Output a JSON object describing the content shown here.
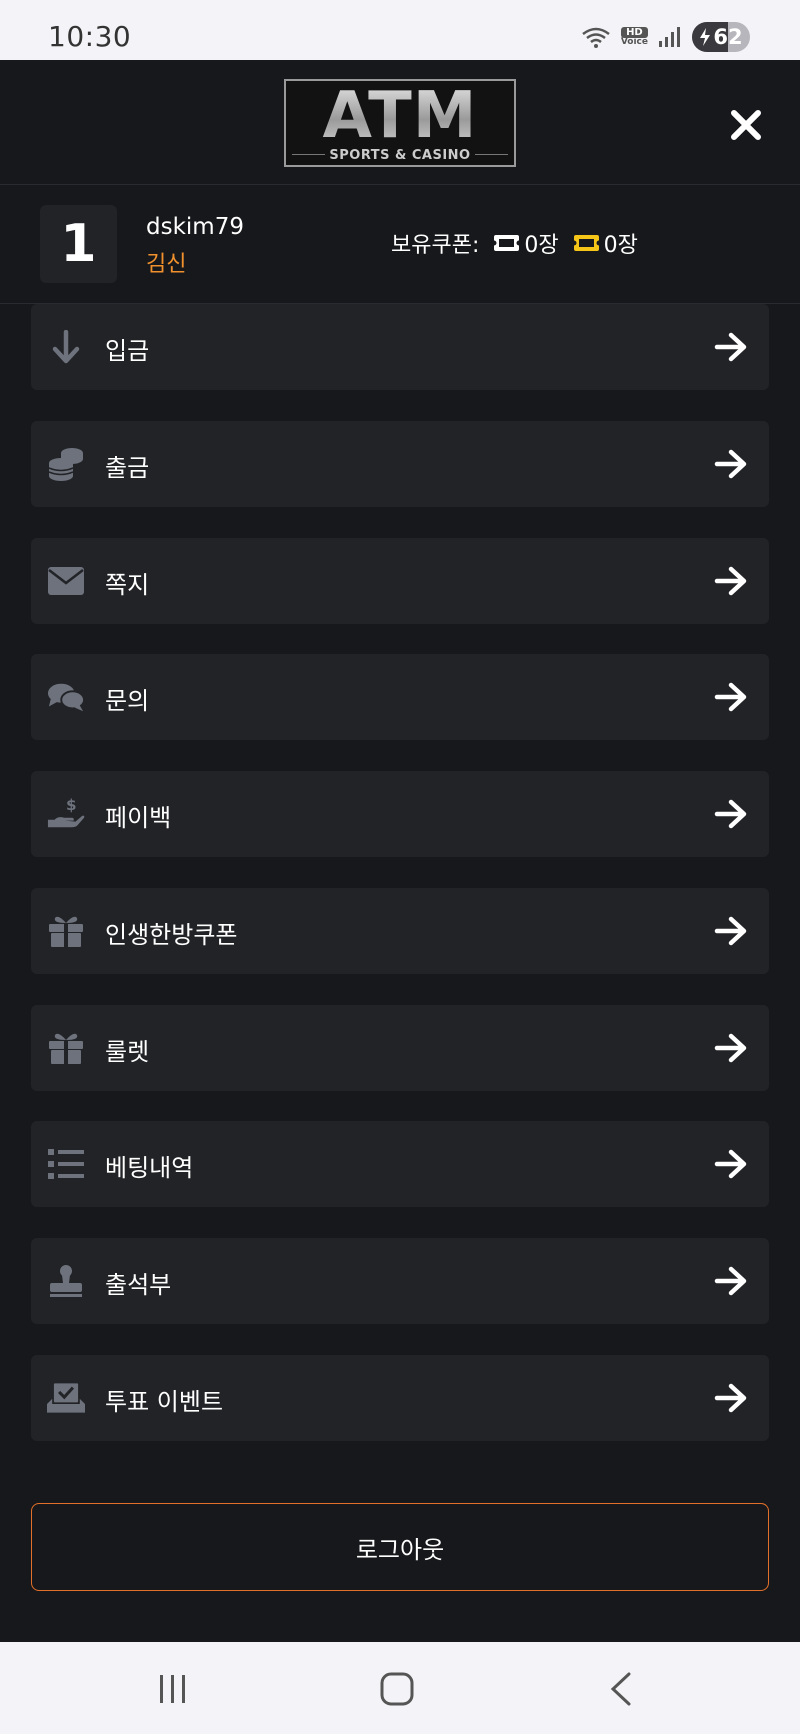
{
  "status_bar": {
    "time": "10:30",
    "hd_top": "HD",
    "hd_bottom": "Voice",
    "battery_level": "62"
  },
  "header": {
    "logo_text": "ATM",
    "logo_tagline": "SPORTS & CASINO",
    "close_icon": "close-icon"
  },
  "user": {
    "level": "1",
    "username": "dskim79",
    "grade": "김신",
    "coupon_label": "보유쿠폰:",
    "coupon_white_count": "0장",
    "coupon_yellow_count": "0장"
  },
  "menu": {
    "items": [
      {
        "label": "입금",
        "icon": "arrow-down-icon"
      },
      {
        "label": "출금",
        "icon": "coins-icon"
      },
      {
        "label": "쪽지",
        "icon": "envelope-icon"
      },
      {
        "label": "문의",
        "icon": "chat-bubbles-icon"
      },
      {
        "label": "페이백",
        "icon": "hand-dollar-icon"
      },
      {
        "label": "인생한방쿠폰",
        "icon": "gift-icon"
      },
      {
        "label": "룰렛",
        "icon": "gift-icon"
      },
      {
        "label": "베팅내역",
        "icon": "list-icon"
      },
      {
        "label": "출석부",
        "icon": "stamp-icon"
      },
      {
        "label": "투표 이벤트",
        "icon": "vote-box-icon"
      }
    ]
  },
  "logout_label": "로그아웃",
  "colors": {
    "background": "#17181b",
    "card": "#222327",
    "accent_orange": "#f0912d",
    "logout_border": "#e2702a",
    "coupon_yellow": "#f5c518",
    "icon_gray": "#6d727c"
  }
}
